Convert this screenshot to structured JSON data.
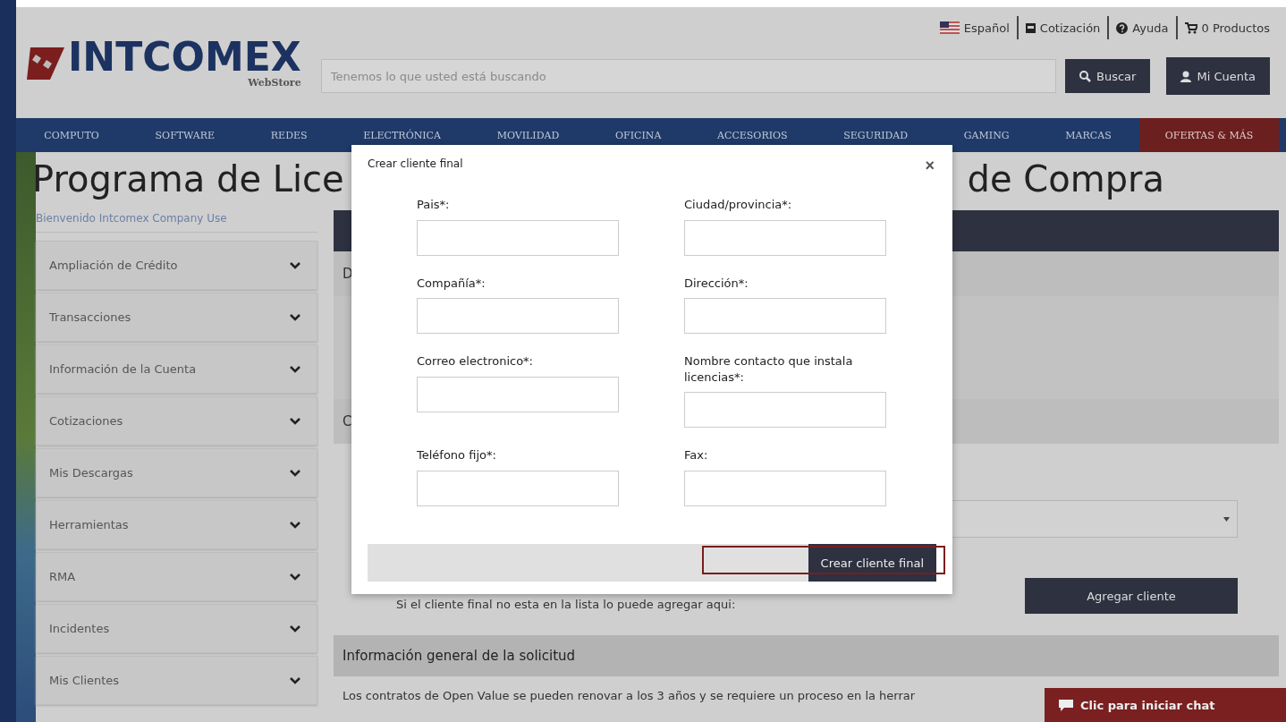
{
  "top_links": [
    {
      "label": "Español"
    },
    {
      "label": "Cotización"
    },
    {
      "label": "Ayuda"
    },
    {
      "label": "0 Productos"
    }
  ],
  "logo": {
    "name": "INTCOMEX",
    "sub": "WebStore"
  },
  "search": {
    "placeholder": "Tenemos lo que usted está buscando",
    "button": "Buscar"
  },
  "account_button": "Mi Cuenta",
  "nav": [
    {
      "label": "COMPUTO",
      "kind": "normal"
    },
    {
      "label": "SOFTWARE",
      "kind": "normal"
    },
    {
      "label": "REDES",
      "kind": "normal"
    },
    {
      "label": "ELECTRÓNICA",
      "kind": "normal"
    },
    {
      "label": "MOVILIDAD",
      "kind": "normal"
    },
    {
      "label": "OFICINA",
      "kind": "normal"
    },
    {
      "label": "ACCESORIOS",
      "kind": "normal"
    },
    {
      "label": "SEGURIDAD",
      "kind": "normal"
    },
    {
      "label": "GAMING",
      "kind": "normal"
    },
    {
      "label": "MARCAS",
      "kind": "normal"
    },
    {
      "label": "OFERTAS & MÁS",
      "kind": "promo"
    }
  ],
  "page_title": {
    "left": "Programa de Lice",
    "right": "de Compra"
  },
  "sidebar": {
    "welcome": "Bienvenido Intcomex Company Use",
    "items": [
      {
        "label": "Ampliación de Crédito",
        "expanded": false
      },
      {
        "label": "Transacciones",
        "expanded": false
      },
      {
        "label": "Información de la Cuenta",
        "expanded": false
      },
      {
        "label": "Cotizaciones",
        "expanded": false
      },
      {
        "label": "Mis Descargas",
        "expanded": false
      },
      {
        "label": "Herramientas",
        "expanded": false
      },
      {
        "label": "RMA",
        "expanded": false
      },
      {
        "label": "Incidentes",
        "expanded": false
      },
      {
        "label": "Mis Clientes",
        "expanded": false
      }
    ]
  },
  "main": {
    "section_letters": [
      "D",
      "C"
    ],
    "hint": "Si el cliente final no esta en la lista lo puede agregar aqui:",
    "add_button": "Agregar cliente",
    "section_title": "Información general de la solicitud",
    "body": "Los contratos de Open Value se pueden renovar a los 3 años y se requiere un proceso en la herrar"
  },
  "modal": {
    "title": "Crear cliente final",
    "close": "×",
    "fields": [
      {
        "label": "Pais*:"
      },
      {
        "label": "Ciudad/provincia*:"
      },
      {
        "label": "Compañía*:"
      },
      {
        "label": "Dirección*:"
      },
      {
        "label": "Correo electronico*:"
      },
      {
        "label": "Nombre contacto que instala licencias*:"
      },
      {
        "label": "Teléfono fijo*:"
      },
      {
        "label": "Fax:"
      }
    ],
    "submit": "Crear cliente final"
  },
  "chat": {
    "label": "Clic para iniciar chat"
  }
}
